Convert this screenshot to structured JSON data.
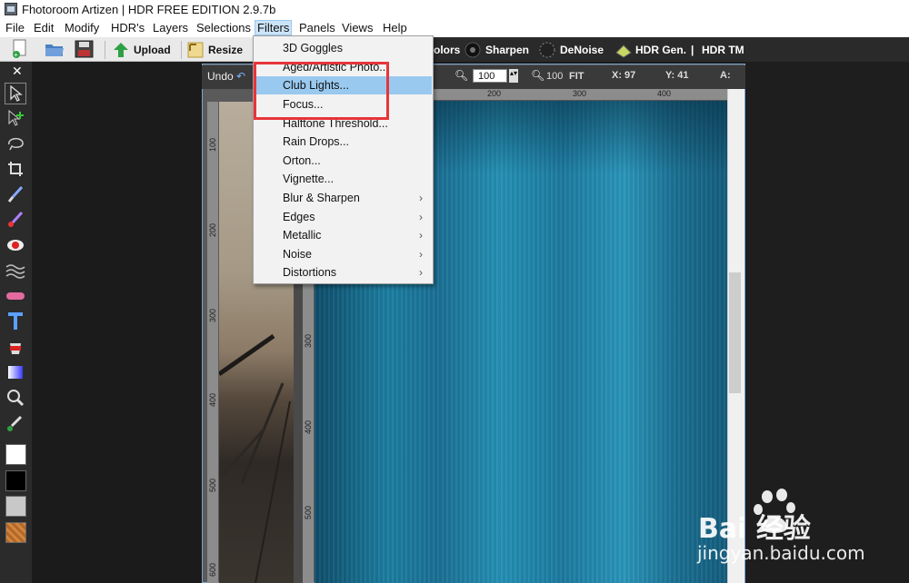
{
  "window": {
    "title": "Fhotoroom Artizen | HDR FREE EDITION 2.9.7b"
  },
  "menubar": {
    "items": [
      "File",
      "Edit",
      "Modify",
      "HDR's",
      "Layers",
      "Selections",
      "Filters",
      "Panels",
      "Views",
      "Help"
    ],
    "active": "Filters"
  },
  "toolbar": {
    "upload": "Upload",
    "resize": "Resize",
    "colors_partial": "olors",
    "sharpen": "Sharpen",
    "denoise": "DeNoise",
    "hdr_gen": "HDR Gen.",
    "sep": "|",
    "hdr_tm": "HDR TM"
  },
  "canvas": {
    "undo": "Undo",
    "zoom": "100",
    "zoom2": "100",
    "fit": "FIT",
    "x_label": "X: 97",
    "y_label": "Y: 41",
    "a_label": "A:",
    "hruler": [
      "200",
      "300",
      "400"
    ],
    "vruler_left": [
      "100",
      "200",
      "300",
      "400",
      "500",
      "600"
    ],
    "vruler_right": [
      "300",
      "400",
      "500"
    ]
  },
  "filters_menu": {
    "items": [
      {
        "label": "3D Goggles",
        "submenu": false
      },
      {
        "label": "Aged/Artistic Photo...",
        "submenu": false
      },
      {
        "label": "Club Lights...",
        "submenu": false,
        "highlighted": true
      },
      {
        "label": "Focus...",
        "submenu": false
      },
      {
        "label": "Halftone Threshold...",
        "submenu": false
      },
      {
        "label": "Rain Drops...",
        "submenu": false
      },
      {
        "label": "Orton...",
        "submenu": false
      },
      {
        "label": "Vignette...",
        "submenu": false
      },
      {
        "label": "Blur & Sharpen",
        "submenu": true
      },
      {
        "label": "Edges",
        "submenu": true
      },
      {
        "label": "Metallic",
        "submenu": true
      },
      {
        "label": "Noise",
        "submenu": true
      },
      {
        "label": "Distortions",
        "submenu": true
      }
    ],
    "submenu_arrow": "›"
  },
  "watermark": {
    "brand": "Bai  经验",
    "url": "jingyan.baidu.com"
  },
  "colors": {
    "highlight": "#99c9ef",
    "annotation": "#e8343a"
  },
  "left_tools": [
    "select-arrow-icon",
    "add-select-icon",
    "lasso-icon",
    "crop-icon",
    "brush-icon",
    "color-brush-icon",
    "redeye-icon",
    "wave-icon",
    "eraser-icon",
    "text-icon",
    "bucket-icon",
    "gradient-icon",
    "zoom-icon",
    "eyedropper-icon"
  ]
}
